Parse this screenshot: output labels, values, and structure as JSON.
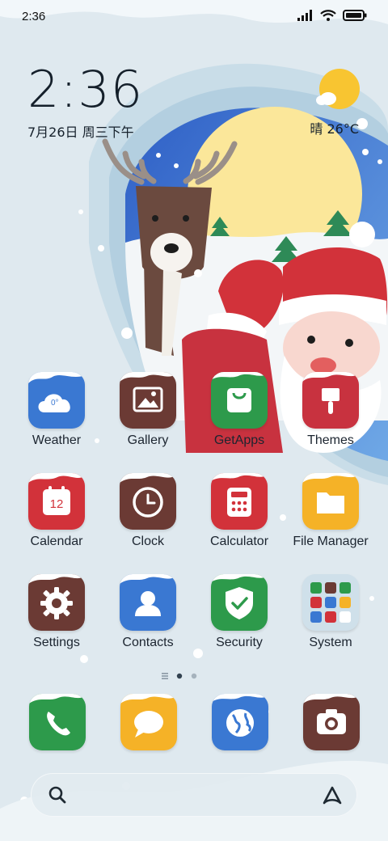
{
  "status_bar": {
    "time": "2:36",
    "icons": [
      "signal-icon",
      "wifi-icon",
      "battery-icon"
    ]
  },
  "clock_widget": {
    "time": "2:36",
    "date": "7月26日 周三下午"
  },
  "weather_widget": {
    "condition_icon": "sun-cloud-icon",
    "text": "晴 26°C"
  },
  "apps": [
    {
      "label": "Weather",
      "icon": "weather-cloud-icon",
      "color": "#3a78d2",
      "detail": "0°"
    },
    {
      "label": "Gallery",
      "icon": "image-icon",
      "color": "#6b3a34"
    },
    {
      "label": "GetApps",
      "icon": "shopping-bag-icon",
      "color": "#2d9a4b"
    },
    {
      "label": "Themes",
      "icon": "paintbrush-icon",
      "color": "#c8323f"
    },
    {
      "label": "Calendar",
      "icon": "calendar-icon",
      "color": "#d2323a",
      "detail": "12"
    },
    {
      "label": "Clock",
      "icon": "clock-icon",
      "color": "#6b3a34"
    },
    {
      "label": "Calculator",
      "icon": "calculator-icon",
      "color": "#d2323a"
    },
    {
      "label": "File Manager",
      "icon": "folder-icon",
      "color": "#f5b227"
    },
    {
      "label": "Settings",
      "icon": "gear-icon",
      "color": "#6b3a34"
    },
    {
      "label": "Contacts",
      "icon": "person-icon",
      "color": "#3a78d2"
    },
    {
      "label": "Security",
      "icon": "shield-check-icon",
      "color": "#2d9a4b"
    },
    {
      "label": "System",
      "icon": "folder-grid-icon",
      "color": "#cfe0ea"
    }
  ],
  "dock": [
    {
      "icon": "phone-icon",
      "color": "#2d9a4b"
    },
    {
      "icon": "message-bubble-icon",
      "color": "#f5b227"
    },
    {
      "icon": "browser-globe-icon",
      "color": "#3a78d2"
    },
    {
      "icon": "camera-icon",
      "color": "#6b3a34"
    }
  ],
  "page_indicator": {
    "pages": 2,
    "current": 1
  },
  "search_bar": {
    "left_icon": "search-icon",
    "right_icon": "assistant-icon"
  }
}
